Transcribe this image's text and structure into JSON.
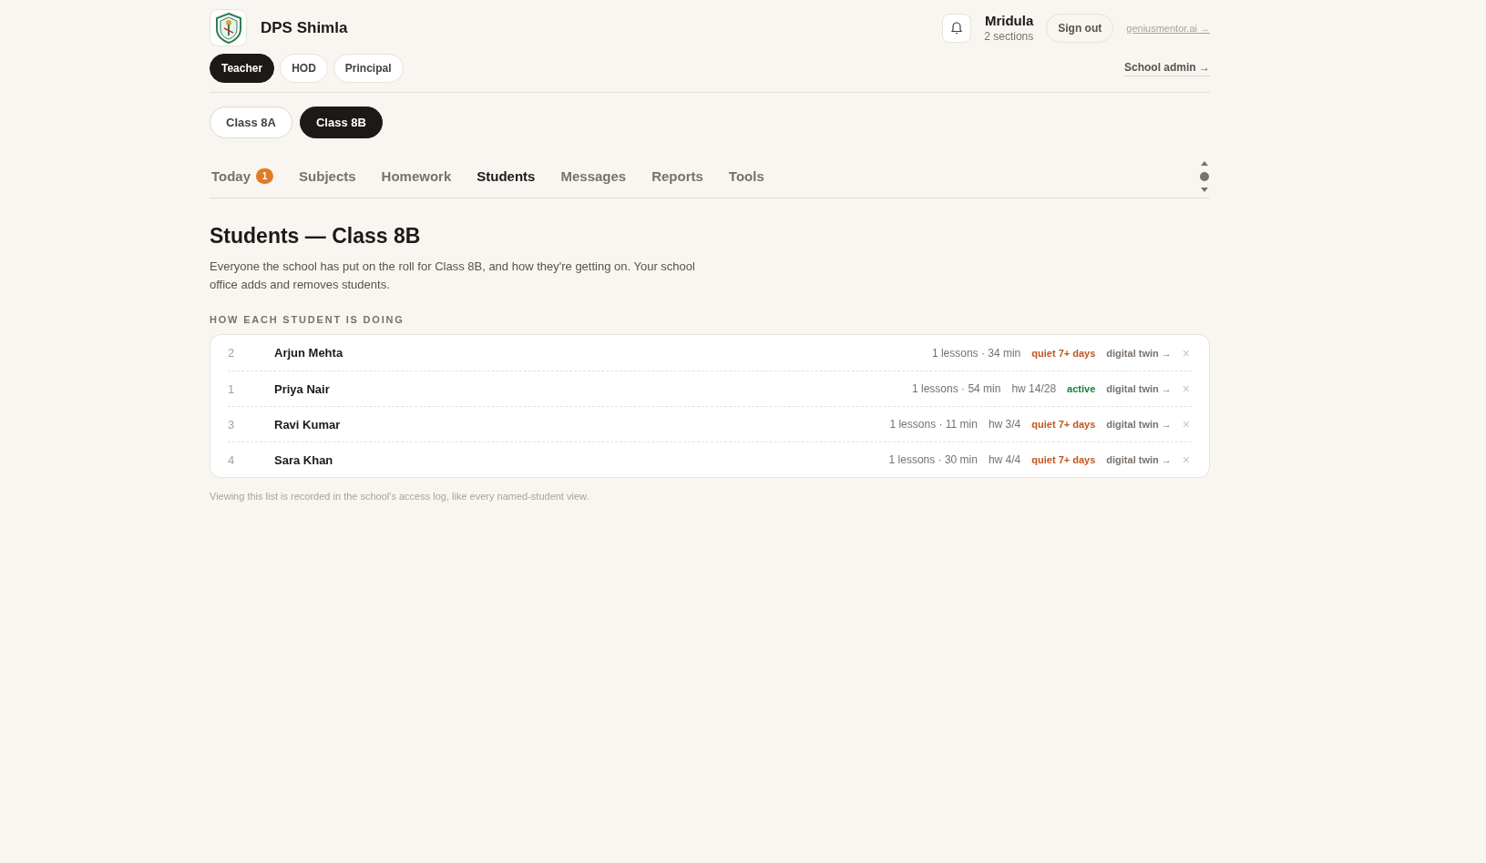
{
  "school": {
    "name": "DPS Shimla"
  },
  "user": {
    "name": "Mridula",
    "detail": "2 sections"
  },
  "header_actions": {
    "sign_out": "Sign out",
    "site_link": "geniusmentor.ai →",
    "admin_link": "School admin →"
  },
  "roles": [
    {
      "label": "Teacher",
      "selected": true
    },
    {
      "label": "HOD",
      "selected": false
    },
    {
      "label": "Principal",
      "selected": false
    }
  ],
  "classes": [
    {
      "label": "Class 8A",
      "selected": false
    },
    {
      "label": "Class 8B",
      "selected": true
    }
  ],
  "tabs": [
    {
      "label": "Today",
      "badge": "1",
      "selected": false
    },
    {
      "label": "Subjects",
      "selected": false
    },
    {
      "label": "Homework",
      "selected": false
    },
    {
      "label": "Students",
      "selected": true
    },
    {
      "label": "Messages",
      "selected": false
    },
    {
      "label": "Reports",
      "selected": false
    },
    {
      "label": "Tools",
      "selected": false
    }
  ],
  "page": {
    "title": "Students — Class 8B",
    "description": "Everyone the school has put on the roll for Class 8B, and how they're getting on. Your school office adds and removes students.",
    "section_label": "HOW EACH STUDENT IS DOING",
    "footnote": "Viewing this list is recorded in the school's access log, like every named-student view."
  },
  "students": [
    {
      "number": "2",
      "name": "Arjun Mehta",
      "activity": "1 lessons · 34 min",
      "status": {
        "text": "quiet 7+ days",
        "kind": "quiet"
      },
      "link": "digital twin →",
      "remove": "×"
    },
    {
      "number": "1",
      "name": "Priya Nair",
      "activity": "1 lessons · 54 min",
      "homework": "hw 14/28",
      "status": {
        "text": "active",
        "kind": "active"
      },
      "link": "digital twin →",
      "remove": "×"
    },
    {
      "number": "3",
      "name": "Ravi Kumar",
      "activity": "1 lessons · 11 min",
      "homework": "hw 3/4",
      "status": {
        "text": "quiet 7+ days",
        "kind": "quiet"
      },
      "link": "digital twin →",
      "remove": "×"
    },
    {
      "number": "4",
      "name": "Sara Khan",
      "activity": "1 lessons · 30 min",
      "homework": "hw 4/4",
      "status": {
        "text": "quiet 7+ days",
        "kind": "quiet"
      },
      "link": "digital twin →",
      "remove": "×"
    }
  ]
}
